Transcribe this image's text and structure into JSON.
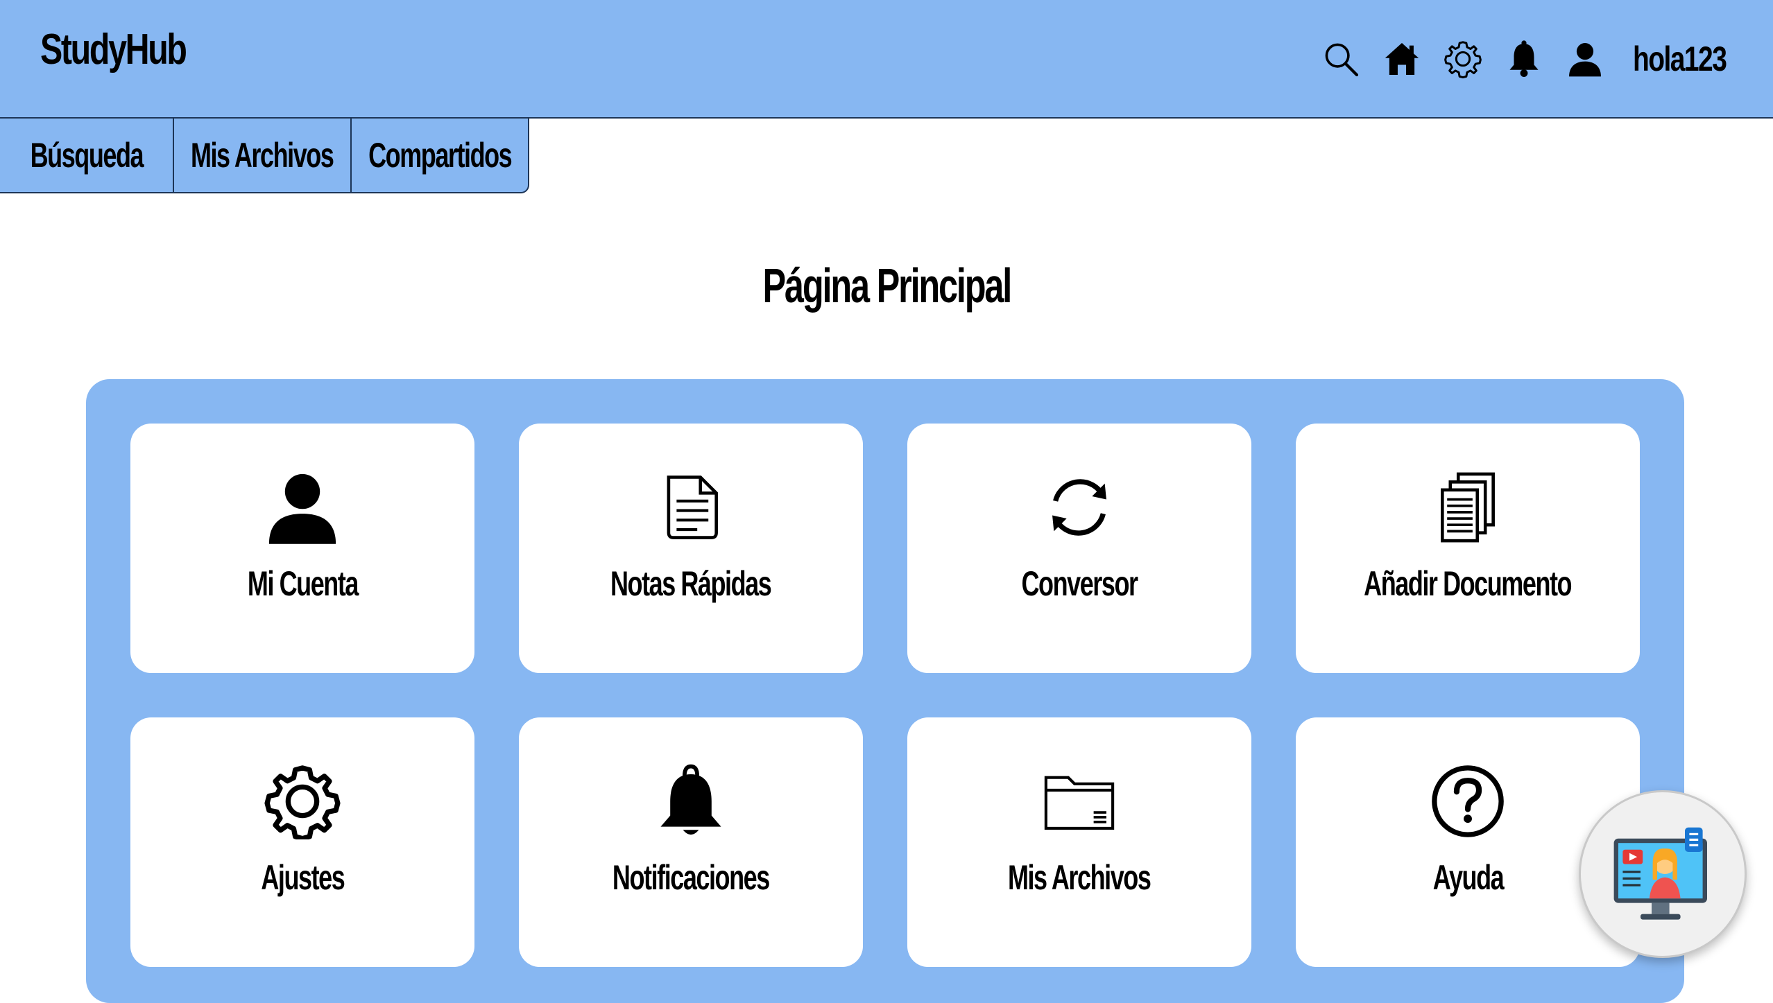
{
  "header": {
    "brand": "StudyHub",
    "username": "hola123",
    "icons": [
      "search-icon",
      "home-icon",
      "gear-icon",
      "bell-icon",
      "user-icon"
    ],
    "background_color": "#87b7f2"
  },
  "tabs": [
    {
      "label": "Búsqueda"
    },
    {
      "label": "Mis Archivos"
    },
    {
      "label": "Compartidos"
    }
  ],
  "main": {
    "title": "Página Principal",
    "panel_color": "#87b7f2",
    "cards": [
      {
        "label": "Mi Cuenta",
        "icon": "user-icon"
      },
      {
        "label": "Notas Rápidas",
        "icon": "note-icon"
      },
      {
        "label": "Conversor",
        "icon": "sync-icon"
      },
      {
        "label": "Añadir Documento",
        "icon": "documents-icon"
      },
      {
        "label": "Ajustes",
        "icon": "gear-icon"
      },
      {
        "label": "Notificaciones",
        "icon": "bell-icon"
      },
      {
        "label": "Mis Archivos",
        "icon": "folder-icon"
      },
      {
        "label": "Ayuda",
        "icon": "help-icon"
      }
    ]
  },
  "assistant": {
    "icon": "tutor-assistant-icon"
  }
}
